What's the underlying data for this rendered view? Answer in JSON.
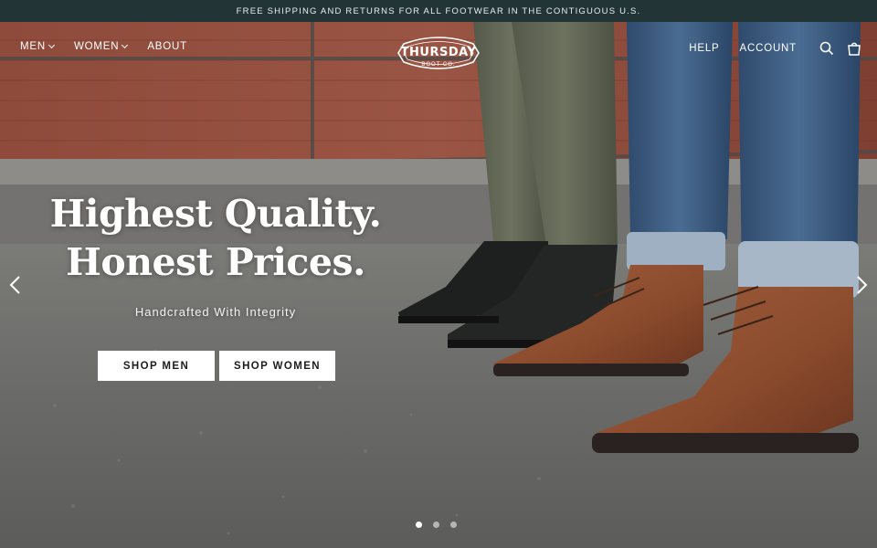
{
  "announcement": "FREE SHIPPING AND RETURNS FOR ALL FOOTWEAR IN THE CONTIGUOUS U.S.",
  "nav": {
    "left": [
      {
        "label": "MEN",
        "has_dropdown": true
      },
      {
        "label": "WOMEN",
        "has_dropdown": true
      },
      {
        "label": "ABOUT",
        "has_dropdown": false
      }
    ],
    "right": [
      {
        "label": "HELP"
      },
      {
        "label": "ACCOUNT"
      }
    ],
    "icons": [
      "search-icon",
      "shopping-bag-icon"
    ]
  },
  "logo": {
    "name": "THURSDAY",
    "sub": "BOOT CO."
  },
  "hero": {
    "headline_line1": "Highest Quality.",
    "headline_line2": "Honest Prices.",
    "subheadline": "Handcrafted With Integrity",
    "cta_men": "SHOP MEN",
    "cta_women": "SHOP WOMEN"
  },
  "slider": {
    "slide_count": 3,
    "active_slide": 1
  },
  "colors": {
    "announcement_bg": "#233437",
    "button_bg": "#ffffff",
    "text_light": "#ffffff"
  }
}
